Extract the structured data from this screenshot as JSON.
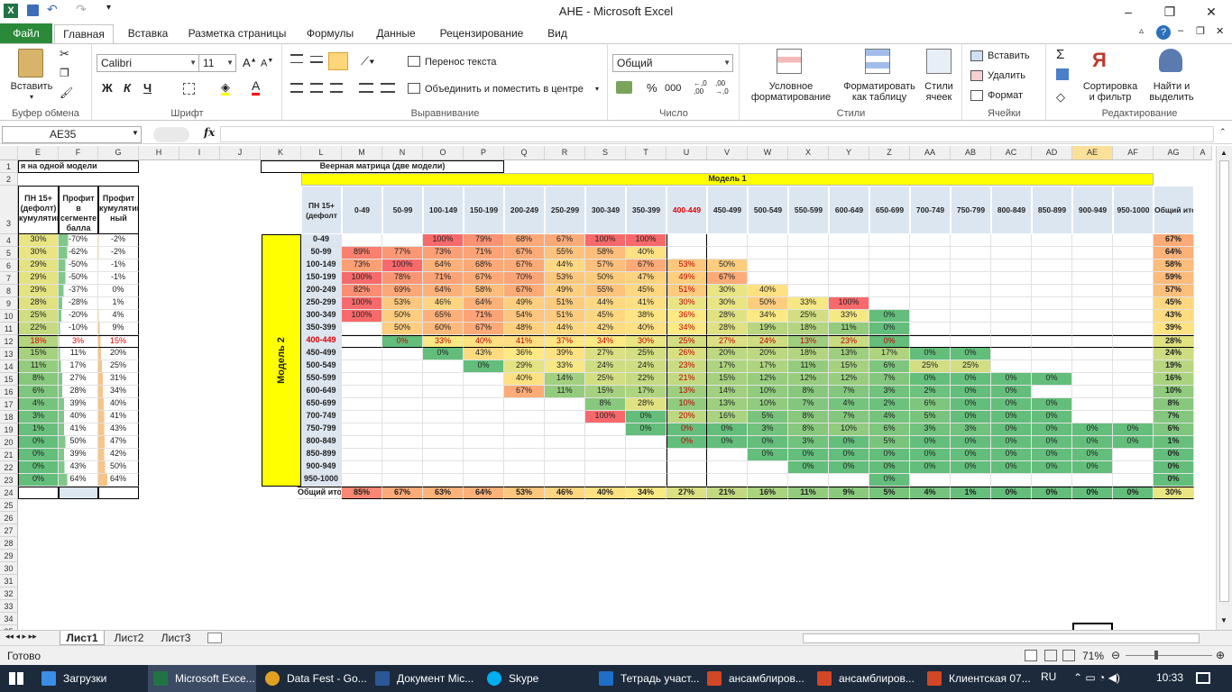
{
  "window": {
    "title": "AHE  -  Microsoft Excel"
  },
  "tabs": {
    "file": "Файл",
    "items": [
      "Главная",
      "Вставка",
      "Разметка страницы",
      "Формулы",
      "Данные",
      "Рецензирование",
      "Вид"
    ]
  },
  "ribbon": {
    "clipboard": {
      "label": "Буфер обмена",
      "paste": "Вставить"
    },
    "font": {
      "label": "Шрифт",
      "name": "Calibri",
      "size": "11",
      "bold": "Ж",
      "italic": "К",
      "underline": "Ч"
    },
    "align": {
      "label": "Выравнивание",
      "wrap": "Перенос текста",
      "merge": "Объединить и поместить в центре"
    },
    "number": {
      "label": "Число",
      "format": "Общий",
      "percent": "%",
      "thousands": "000"
    },
    "styles": {
      "label": "Стили",
      "cond": "Условное форматирование",
      "table": "Форматировать как таблицу",
      "cell": "Стили ячеек"
    },
    "cells": {
      "label": "Ячейки",
      "insert": "Вставить",
      "delete": "Удалить",
      "format": "Формат"
    },
    "edit": {
      "label": "Редактирование",
      "sigma": "Σ",
      "sort": "Сортировка и фильтр",
      "find": "Найти и выделить"
    }
  },
  "formula": {
    "namebox": "AE35",
    "fx": "fx",
    "value": ""
  },
  "grid": {
    "columns": [
      "E",
      "F",
      "G",
      "H",
      "I",
      "J",
      "K",
      "L",
      "M",
      "N",
      "O",
      "P",
      "Q",
      "R",
      "S",
      "T",
      "U",
      "V",
      "W",
      "X",
      "Y",
      "Z",
      "AA",
      "AB",
      "AC",
      "AD",
      "AE",
      "AF",
      "AG",
      "A"
    ],
    "rows": [
      "1",
      "2",
      "3",
      "4",
      "5",
      "6",
      "7",
      "8",
      "9",
      "10",
      "11",
      "12",
      "13",
      "14",
      "15",
      "16",
      "17",
      "18",
      "19",
      "20",
      "21",
      "22",
      "23",
      "24",
      "25",
      "26",
      "27",
      "28",
      "29",
      "30",
      "31",
      "32",
      "33",
      "34",
      "35"
    ],
    "left_title": "я на одной модели",
    "left_headers": [
      "ПН 15+ (дефолт) кумулятив",
      "Профит в сегменте балла",
      "Профит кумулятив ный"
    ],
    "left_rows": [
      [
        "30%",
        "-70%",
        "-2%"
      ],
      [
        "30%",
        "-62%",
        "-2%"
      ],
      [
        "29%",
        "-50%",
        "-1%"
      ],
      [
        "29%",
        "-50%",
        "-1%"
      ],
      [
        "29%",
        "-37%",
        "0%"
      ],
      [
        "28%",
        "-28%",
        "1%"
      ],
      [
        "25%",
        "-20%",
        "4%"
      ],
      [
        "22%",
        "-10%",
        "9%"
      ],
      [
        "18%",
        "3%",
        "15%"
      ],
      [
        "15%",
        "11%",
        "20%"
      ],
      [
        "11%",
        "17%",
        "25%"
      ],
      [
        "8%",
        "27%",
        "31%"
      ],
      [
        "6%",
        "28%",
        "34%"
      ],
      [
        "4%",
        "39%",
        "40%"
      ],
      [
        "3%",
        "40%",
        "41%"
      ],
      [
        "1%",
        "41%",
        "43%"
      ],
      [
        "0%",
        "50%",
        "47%"
      ],
      [
        "0%",
        "39%",
        "42%"
      ],
      [
        "0%",
        "43%",
        "50%"
      ],
      [
        "0%",
        "64%",
        "64%"
      ]
    ],
    "matrix_title": "Веерная матрица (две модели)",
    "model1": "Модель 1",
    "model2": "Модель 2",
    "corner": "ПН 15+ (дефолт",
    "col_bins": [
      "0-49",
      "50-99",
      "100-149",
      "150-199",
      "200-249",
      "250-299",
      "300-349",
      "350-399",
      "400-449",
      "450-499",
      "500-549",
      "550-599",
      "600-649",
      "650-699",
      "700-749",
      "750-799",
      "800-849",
      "850-899",
      "900-949",
      "950-1000"
    ],
    "total_label": "Общий итог",
    "row_bins": [
      "0-49",
      "50-99",
      "100-149",
      "150-199",
      "200-249",
      "250-299",
      "300-349",
      "350-399",
      "400-449",
      "450-499",
      "500-549",
      "550-599",
      "600-649",
      "650-699",
      "700-749",
      "750-799",
      "800-849",
      "850-899",
      "900-949",
      "950-1000"
    ],
    "total_row_label": "Общий итог",
    "matrix": [
      [
        "",
        "",
        "100%",
        "79%",
        "68%",
        "67%",
        "100%",
        "100%",
        "",
        "",
        "",
        "",
        "",
        "",
        "",
        "",
        "",
        "",
        "",
        "",
        "67%"
      ],
      [
        "89%",
        "77%",
        "73%",
        "71%",
        "67%",
        "55%",
        "58%",
        "40%",
        "",
        "",
        "",
        "",
        "",
        "",
        "",
        "",
        "",
        "",
        "",
        "",
        "64%"
      ],
      [
        "73%",
        "100%",
        "64%",
        "68%",
        "67%",
        "44%",
        "57%",
        "67%",
        "53%",
        "50%",
        "",
        "",
        "",
        "",
        "",
        "",
        "",
        "",
        "",
        "",
        "58%"
      ],
      [
        "100%",
        "78%",
        "71%",
        "67%",
        "70%",
        "53%",
        "50%",
        "47%",
        "49%",
        "67%",
        "",
        "",
        "",
        "",
        "",
        "",
        "",
        "",
        "",
        "",
        "59%"
      ],
      [
        "82%",
        "69%",
        "64%",
        "58%",
        "67%",
        "49%",
        "55%",
        "45%",
        "51%",
        "30%",
        "40%",
        "",
        "",
        "",
        "",
        "",
        "",
        "",
        "",
        "",
        "57%"
      ],
      [
        "100%",
        "53%",
        "46%",
        "64%",
        "49%",
        "51%",
        "44%",
        "41%",
        "30%",
        "30%",
        "50%",
        "33%",
        "100%",
        "",
        "",
        "",
        "",
        "",
        "",
        "",
        "45%"
      ],
      [
        "100%",
        "50%",
        "65%",
        "71%",
        "54%",
        "51%",
        "45%",
        "38%",
        "36%",
        "28%",
        "34%",
        "25%",
        "33%",
        "0%",
        "",
        "",
        "",
        "",
        "",
        "",
        "43%"
      ],
      [
        "",
        "50%",
        "60%",
        "67%",
        "48%",
        "44%",
        "42%",
        "40%",
        "34%",
        "28%",
        "19%",
        "18%",
        "11%",
        "0%",
        "",
        "",
        "",
        "",
        "",
        "",
        "39%"
      ],
      [
        "",
        "0%",
        "33%",
        "40%",
        "41%",
        "37%",
        "34%",
        "30%",
        "25%",
        "27%",
        "24%",
        "13%",
        "23%",
        "0%",
        "",
        "",
        "",
        "",
        "",
        "",
        "28%"
      ],
      [
        "",
        "",
        "0%",
        "43%",
        "36%",
        "39%",
        "27%",
        "25%",
        "26%",
        "20%",
        "20%",
        "18%",
        "13%",
        "17%",
        "0%",
        "0%",
        "",
        "",
        "",
        "",
        "24%"
      ],
      [
        "",
        "",
        "",
        "0%",
        "29%",
        "33%",
        "24%",
        "24%",
        "23%",
        "17%",
        "17%",
        "11%",
        "15%",
        "6%",
        "25%",
        "25%",
        "",
        "",
        "",
        "",
        "19%"
      ],
      [
        "",
        "",
        "",
        "",
        "40%",
        "14%",
        "25%",
        "22%",
        "21%",
        "15%",
        "12%",
        "12%",
        "12%",
        "7%",
        "0%",
        "0%",
        "0%",
        "0%",
        "",
        "",
        "16%"
      ],
      [
        "",
        "",
        "",
        "",
        "67%",
        "11%",
        "15%",
        "17%",
        "13%",
        "14%",
        "10%",
        "8%",
        "7%",
        "3%",
        "2%",
        "0%",
        "0%",
        "",
        "",
        "",
        "10%"
      ],
      [
        "",
        "",
        "",
        "",
        "",
        "",
        "8%",
        "28%",
        "10%",
        "13%",
        "10%",
        "7%",
        "4%",
        "2%",
        "6%",
        "0%",
        "0%",
        "0%",
        "",
        "",
        "8%"
      ],
      [
        "",
        "",
        "",
        "",
        "",
        "",
        "100%",
        "0%",
        "20%",
        "16%",
        "5%",
        "8%",
        "7%",
        "4%",
        "5%",
        "0%",
        "0%",
        "0%",
        "",
        "",
        "7%"
      ],
      [
        "",
        "",
        "",
        "",
        "",
        "",
        "",
        "0%",
        "0%",
        "0%",
        "3%",
        "8%",
        "10%",
        "6%",
        "3%",
        "3%",
        "0%",
        "0%",
        "0%",
        "0%",
        "6%"
      ],
      [
        "",
        "",
        "",
        "",
        "",
        "",
        "",
        "",
        "0%",
        "0%",
        "0%",
        "3%",
        "0%",
        "5%",
        "0%",
        "0%",
        "0%",
        "0%",
        "0%",
        "0%",
        "1%"
      ],
      [
        "",
        "",
        "",
        "",
        "",
        "",
        "",
        "",
        "",
        "",
        "0%",
        "0%",
        "0%",
        "0%",
        "0%",
        "0%",
        "0%",
        "0%",
        "0%",
        "",
        "0%"
      ],
      [
        "",
        "",
        "",
        "",
        "",
        "",
        "",
        "",
        "",
        "",
        "",
        "0%",
        "0%",
        "0%",
        "0%",
        "0%",
        "0%",
        "0%",
        "0%",
        "",
        "0%"
      ],
      [
        "",
        "",
        "",
        "",
        "",
        "",
        "",
        "",
        "",
        "",
        "",
        "",
        "",
        "0%",
        "",
        "",
        "",
        "",
        "",
        "",
        "0%"
      ]
    ],
    "totals": [
      "85%",
      "67%",
      "63%",
      "64%",
      "53%",
      "46%",
      "40%",
      "34%",
      "27%",
      "21%",
      "16%",
      "11%",
      "9%",
      "5%",
      "4%",
      "1%",
      "0%",
      "0%",
      "0%",
      "0%",
      "30%"
    ]
  },
  "sheets": [
    "Лист1",
    "Лист2",
    "Лист3"
  ],
  "status": {
    "ready": "Готово",
    "zoom": "71%"
  },
  "taskbar": {
    "items": [
      "Загрузки",
      "Microsoft Exce...",
      "Data Fest - Go...",
      "Документ Mic...",
      "Skype",
      "Тетрадь участ...",
      "ансамблиров...",
      "ансамблиров...",
      "Клиентская 07..."
    ],
    "lang": "RU",
    "time": "10:33"
  },
  "colors": {
    "excel_green": "#217346",
    "file_tab": "#2a8a3a",
    "yellow": "#ffff00",
    "header_blue": "#dce6f1"
  }
}
